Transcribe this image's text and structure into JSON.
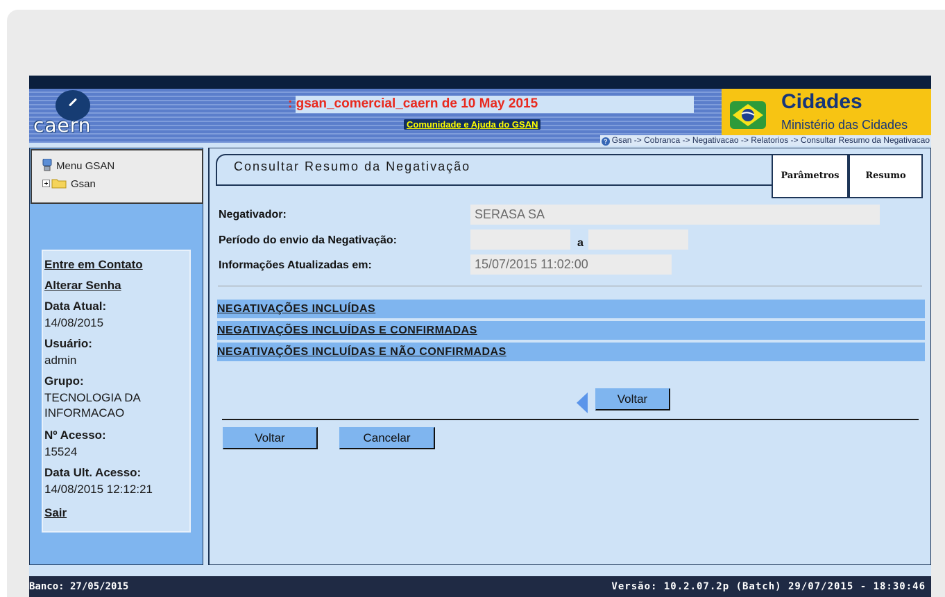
{
  "header": {
    "logo_text": "caern",
    "system_title": ": gsan_comercial_caern de 10 May 2015",
    "community_link": "Comunidade e Ajuda do GSAN",
    "gov_title": "Cidades",
    "gov_subtitle": "Ministério das Cidades",
    "breadcrumb": "Gsan -> Cobranca -> Negativacao -> Relatorios -> Consultar Resumo da Negativacao"
  },
  "sidebar": {
    "menu_title": "Menu GSAN",
    "menu_root": "Gsan",
    "contact_link": "Entre em Contato",
    "change_password_link": "Alterar Senha",
    "current_date_label": "Data Atual:",
    "current_date": "14/08/2015",
    "user_label": "Usuário:",
    "user": "admin",
    "group_label": "Grupo:",
    "group_line1": "TECNOLOGIA DA",
    "group_line2": "INFORMACAO",
    "access_count_label": "Nº Acesso:",
    "access_count": "15524",
    "last_access_label": "Data Ult. Acesso:",
    "last_access": "14/08/2015 12:12:21",
    "logout_link": "Sair"
  },
  "form": {
    "title": "Consultar Resumo da Negativação",
    "tabs": [
      {
        "label": "Parâmetros"
      },
      {
        "label": "Resumo"
      }
    ],
    "negativador_label": "Negativador:",
    "negativador_value": "SERASA SA",
    "periodo_label": "Período do envio da Negativação:",
    "periodo_start": "",
    "periodo_separator": "a",
    "periodo_end": "",
    "atualizadas_label": "Informações Atualizadas em:",
    "atualizadas_value": "15/07/2015 11:02:00",
    "sections": [
      {
        "label": "NEGATIVAÇÕES INCLUÍDAS"
      },
      {
        "label": "NEGATIVAÇÕES INCLUÍDAS E CONFIRMADAS"
      },
      {
        "label": "NEGATIVAÇÕES INCLUÍDAS E NÃO CONFIRMADAS"
      }
    ],
    "back_label": "Voltar",
    "bottom_back_label": "Voltar",
    "cancel_label": "Cancelar"
  },
  "footer": {
    "bank": "Banco: 27/05/2015",
    "version": "Versão: 10.2.07.2p (Batch) 29/07/2015 - 18:30:46"
  },
  "colors": {
    "page_background": "#cfe3f7",
    "sidebar_background": "#7fb5ef",
    "title_red": "#e8291e",
    "gov_yellow": "#f7c413",
    "footer_background": "#1f2a44"
  }
}
